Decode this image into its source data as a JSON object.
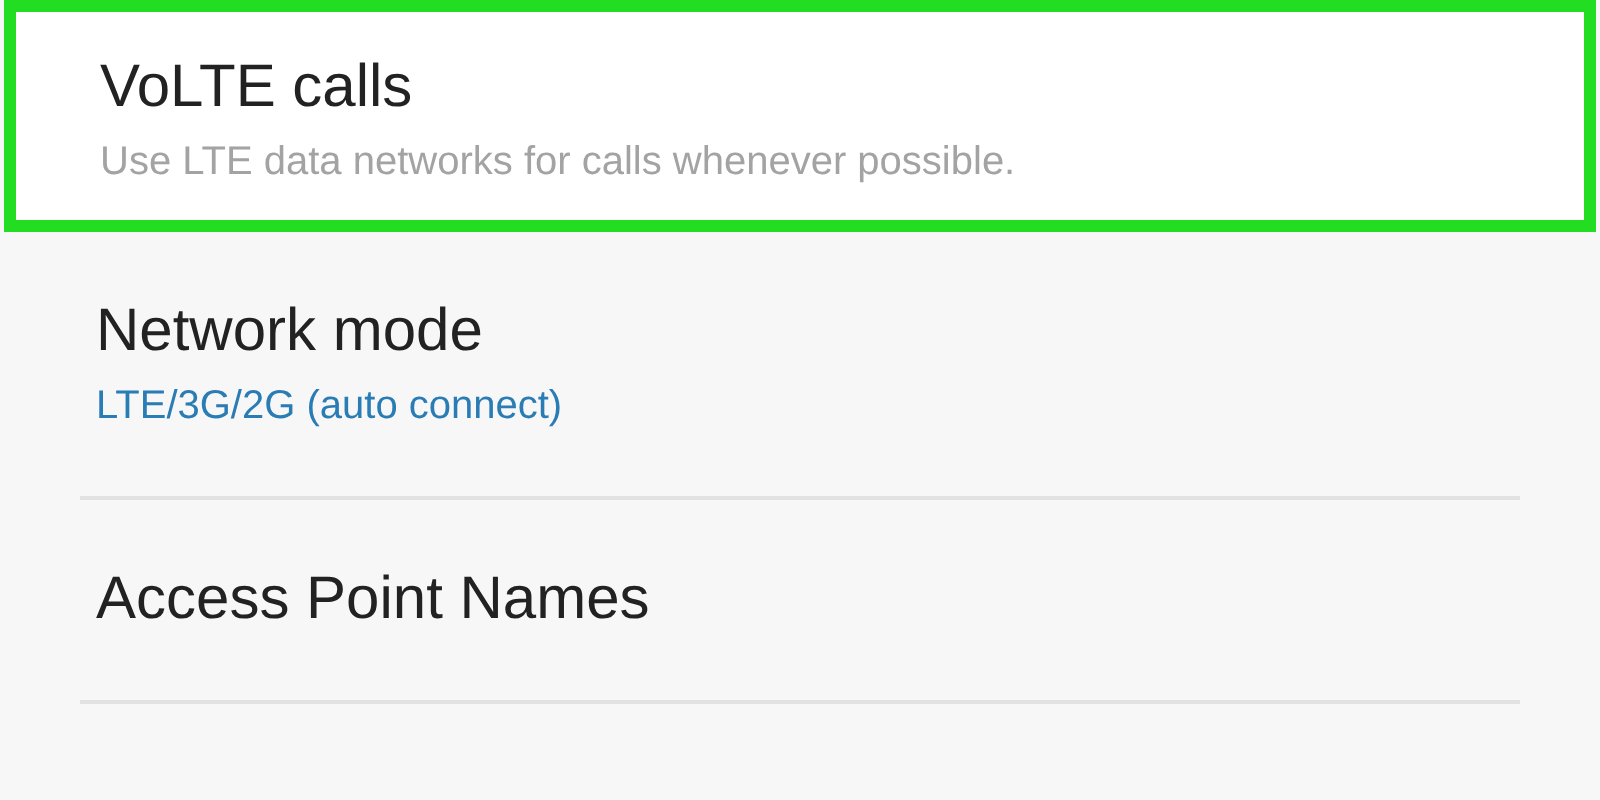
{
  "settings": [
    {
      "title": "VoLTE calls",
      "subtitle": {
        "kind": "description",
        "text": "Use LTE data networks for calls whenever possible."
      },
      "highlighted": true
    },
    {
      "title": "Network mode",
      "subtitle": {
        "kind": "value",
        "text": "LTE/3G/2G (auto connect)"
      },
      "highlighted": false
    },
    {
      "title": "Access Point Names",
      "highlighted": false
    }
  ]
}
